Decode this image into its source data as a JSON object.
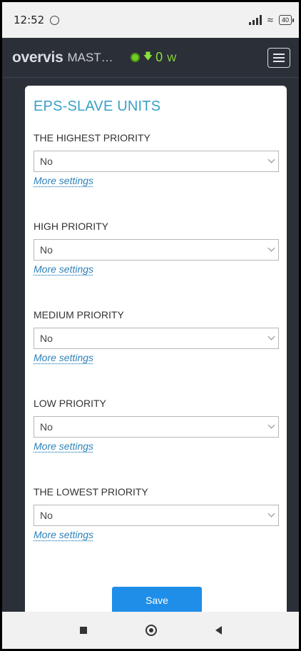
{
  "status": {
    "time": "12:52",
    "battery": "40"
  },
  "header": {
    "logo": "overvis",
    "device": "MAST…",
    "power_value": "0",
    "power_unit": "W",
    "indicator_color": "#6fd11f"
  },
  "card": {
    "title": "EPS-SLAVE UNITS",
    "groups": [
      {
        "label": "THE HIGHEST PRIORITY",
        "value": "No",
        "link": "More settings"
      },
      {
        "label": "HIGH PRIORITY",
        "value": "No",
        "link": "More settings"
      },
      {
        "label": "MEDIUM PRIORITY",
        "value": "No",
        "link": "More settings"
      },
      {
        "label": "LOW PRIORITY",
        "value": "No",
        "link": "More settings"
      },
      {
        "label": "THE LOWEST PRIORITY",
        "value": "No",
        "link": "More settings"
      }
    ],
    "save_label": "Save"
  },
  "colors": {
    "accent": "#1f8ee8",
    "title": "#3aa0c8",
    "header_bg": "#2b2f38"
  }
}
